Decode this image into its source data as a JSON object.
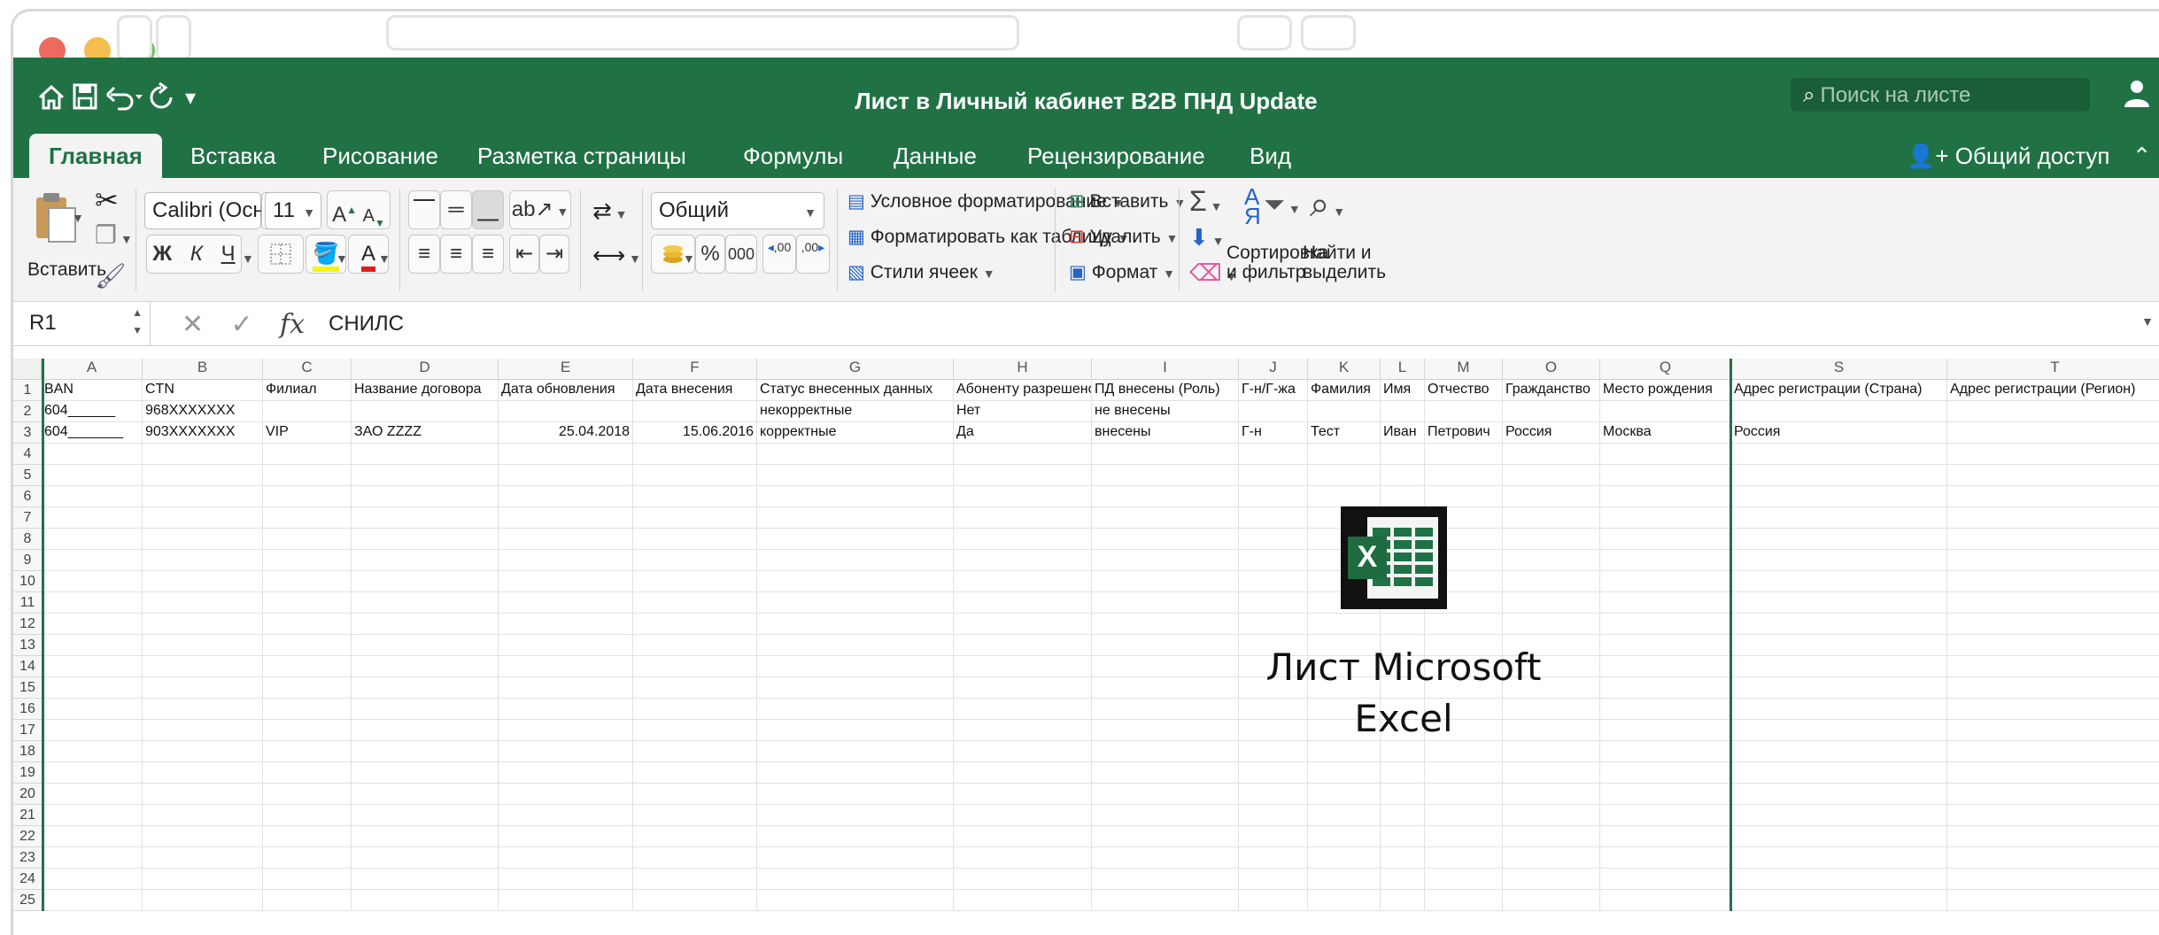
{
  "document": {
    "title": "Лист в Личный кабинет B2B ПНД Update",
    "search_placeholder": "Поиск на листе"
  },
  "ribbon_tabs": [
    "Главная",
    "Вставка",
    "Рисование",
    "Разметка страницы",
    "Формулы",
    "Данные",
    "Рецензирование",
    "Вид"
  ],
  "share_label": "Общий доступ",
  "ribbon": {
    "paste_label": "Вставить",
    "font_name": "Calibri (Осн...",
    "font_size": "11",
    "bold": "Ж",
    "italic": "К",
    "underline": "Ч",
    "number_format": "Общий",
    "percent": "%",
    "thousands": "000",
    "conditional_formatting": "Условное форматирование",
    "format_as_table": "Форматировать как таблицу",
    "cell_styles": "Стили ячеек",
    "insert": "Вставить",
    "delete": "Удалить",
    "format": "Формат",
    "sort_filter_line1": "Сортировка",
    "sort_filter_line2": "и фильтр",
    "find_select_line1": "Найти и",
    "find_select_line2": "выделить",
    "inc_decimal": ",00",
    "dec_decimal": ",00"
  },
  "formula_bar": {
    "name_box": "R1",
    "formula": "СНИЛС"
  },
  "sheet": {
    "columns": [
      "A",
      "B",
      "C",
      "D",
      "E",
      "F",
      "G",
      "H",
      "I",
      "J",
      "K",
      "L",
      "M",
      "O",
      "Q",
      "S",
      "T"
    ],
    "row_numbers": [
      "1",
      "2",
      "3",
      "4",
      "5",
      "6",
      "7",
      "8",
      "9",
      "10",
      "11",
      "12",
      "13",
      "14",
      "15",
      "16",
      "17",
      "18",
      "19",
      "20",
      "21",
      "22",
      "23",
      "24",
      "25"
    ],
    "rows": [
      [
        "BAN",
        "CTN",
        "Филиал",
        "Название договора",
        "Дата обновления",
        "Дата внесения",
        "Статус внесенных данных",
        "Абоненту разрешено",
        "ПД внесены (Роль)",
        "Г-н/Г-жа",
        "Фамилия",
        "Имя",
        "Отчество",
        "Гражданство",
        "Место рождения",
        "Адрес регистрации (Страна)",
        "Адрес регистрации (Регион)"
      ],
      [
        "604______",
        "968XXXXXXX",
        "",
        "",
        "",
        "",
        "некорректные",
        "Нет",
        "не внесены",
        "",
        "",
        "",
        "",
        "",
        "",
        "",
        ""
      ],
      [
        "604_______",
        "903XXXXXXX",
        "VIP",
        "ЗАО ZZZZ",
        "25.04.2018",
        "15.06.2016",
        "корректные",
        "Да",
        "внесены",
        "Г-н",
        "Тест",
        "Иван",
        "Петрович",
        "Россия",
        "Москва",
        "Россия",
        ""
      ]
    ]
  },
  "embedded_object": {
    "caption_line1": "Лист Microsoft",
    "caption_line2": "Excel",
    "icon_letter": "X"
  },
  "colors": {
    "excel_green": "#207245",
    "ribbon_bg": "#f3f3f3"
  }
}
